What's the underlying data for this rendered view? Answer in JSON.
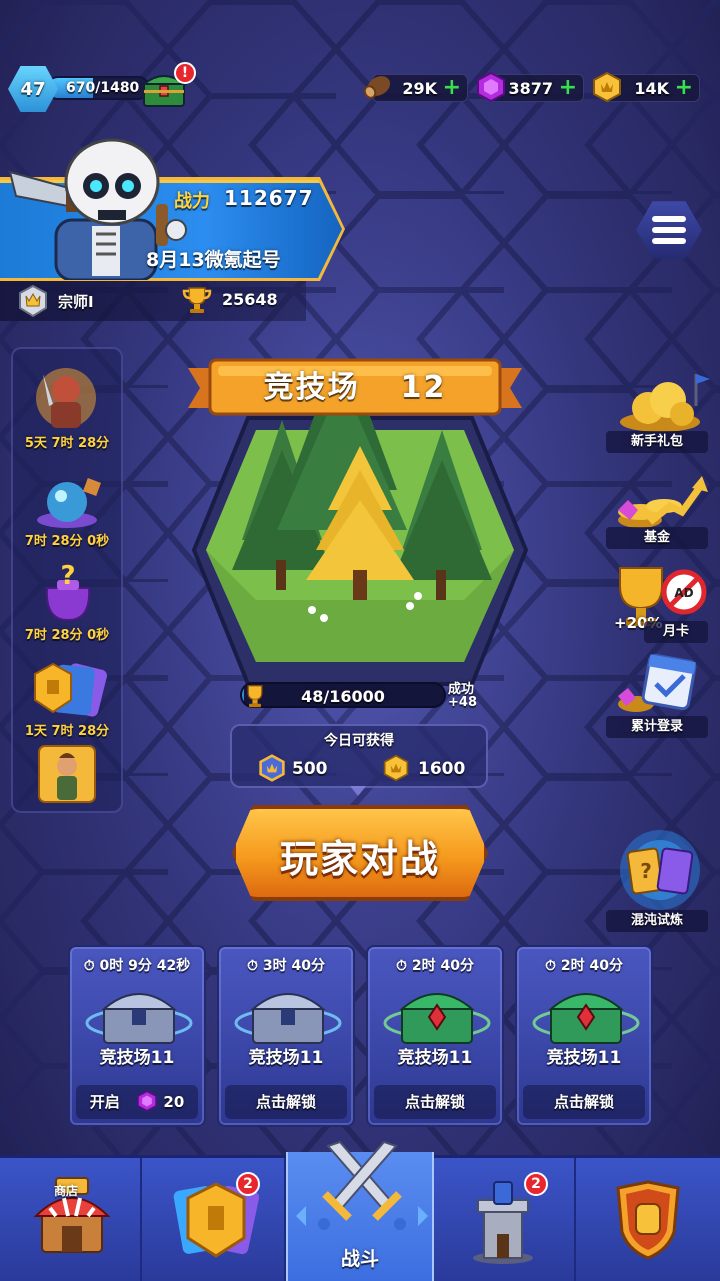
{
  "player": {
    "level": "47",
    "xp": "670/1480",
    "xp_fraction": 0.45,
    "power_label": "战力",
    "power_value": "112677",
    "name": "8月13微氪起号",
    "rank": "宗师I",
    "trophies": "25648"
  },
  "resources": [
    {
      "name": "wood",
      "value": "29K",
      "icon": "wood-log-icon"
    },
    {
      "name": "gem",
      "value": "3877",
      "icon": "purple-gem-icon"
    },
    {
      "name": "gold",
      "value": "14K",
      "icon": "gold-coin-icon"
    }
  ],
  "alert": "!",
  "events": [
    {
      "timer": "5天 7时 28分",
      "icon": "warrior-event-icon"
    },
    {
      "timer": "7时 28分 0秒",
      "icon": "crystal-ball-icon"
    },
    {
      "timer": "7时 28分 0秒",
      "icon": "mystery-bag-icon"
    },
    {
      "timer": "1天 7时 28分",
      "icon": "card-pack-icon"
    },
    {
      "timer": "",
      "icon": "hero-archer-icon"
    }
  ],
  "arena": {
    "title": "竞技场",
    "number": "12",
    "progress_text": "48/16000",
    "progress_fraction": 0.003,
    "success_label": "成功",
    "success_value": "+48"
  },
  "today": {
    "title": "今日可获得",
    "reward_1": "500",
    "reward_2": "1600"
  },
  "battle_button": "玩家对战",
  "right_menu": [
    {
      "label": "新手礼包",
      "icon": "gold-pile-icon"
    },
    {
      "label": "基金",
      "icon": "coin-chart-icon"
    },
    {
      "label": "月卡",
      "icon": "trophy-noad-icon",
      "bonus": "+20%"
    },
    {
      "label": "累计登录",
      "icon": "calendar-icon"
    },
    {
      "label": "混沌试炼",
      "icon": "chaos-portal-icon"
    }
  ],
  "chests": [
    {
      "timer": "0时 9分 42秒",
      "name": "竞技场11",
      "type": "silver",
      "action": "开启",
      "cost": "20"
    },
    {
      "timer": "3时 40分",
      "name": "竞技场11",
      "type": "silver",
      "action": "点击解锁"
    },
    {
      "timer": "2时 40分",
      "name": "竞技场11",
      "type": "emerald",
      "action": "点击解锁"
    },
    {
      "timer": "2时 40分",
      "name": "竞技场11",
      "type": "emerald",
      "action": "点击解锁"
    }
  ],
  "nav": {
    "shop_label": "商店",
    "battle_label": "战斗",
    "cards_badge": "2",
    "tower_badge": "2"
  }
}
